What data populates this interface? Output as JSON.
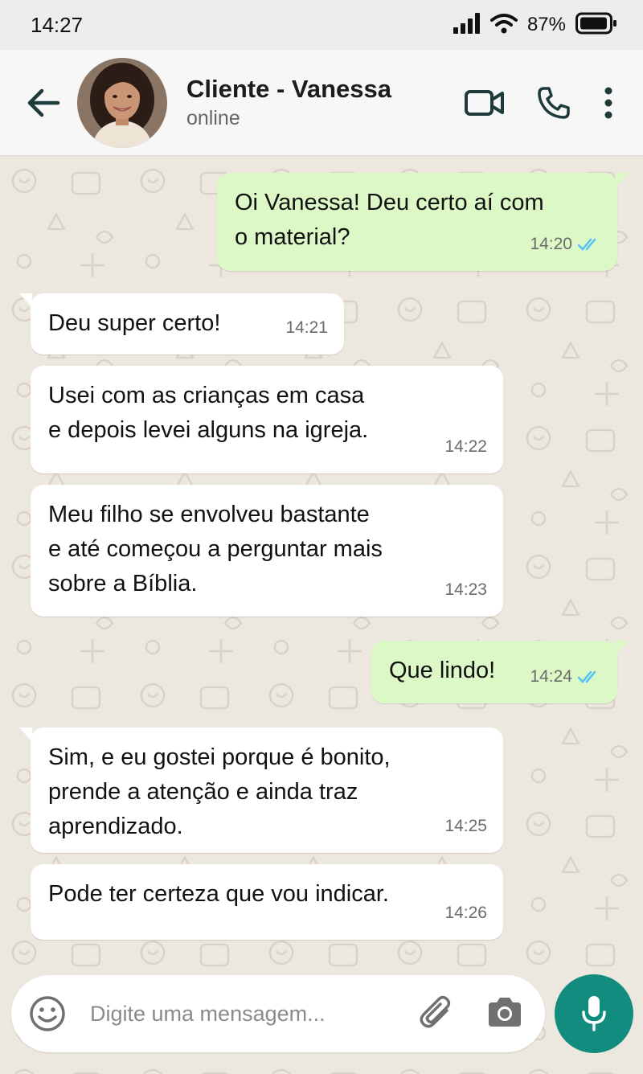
{
  "status_bar": {
    "time": "14:27",
    "battery": "87%"
  },
  "header": {
    "contact_name": "Cliente - Vanessa",
    "contact_status": "online"
  },
  "messages": [
    {
      "dir": "out",
      "text": "Oi Vanessa! Deu certo aí com\no material?",
      "time": "14:20",
      "read": true
    },
    {
      "dir": "in",
      "text": "Deu super certo!",
      "time": "14:21"
    },
    {
      "dir": "in",
      "text": "Usei com as crianças em casa\ne depois levei alguns na igreja.",
      "time": "14:22"
    },
    {
      "dir": "in",
      "text": "Meu filho se envolveu bastante\ne até começou a perguntar mais\nsobre a Bíblia.",
      "time": "14:23"
    },
    {
      "dir": "out",
      "text": "Que lindo!",
      "time": "14:24",
      "read": true
    },
    {
      "dir": "in",
      "text": "Sim, e eu gostei porque é bonito,\nprende a atenção e ainda traz\naprendizado.",
      "time": "14:25"
    },
    {
      "dir": "in",
      "text": "Pode ter certeza que vou indicar.",
      "time": "14:26"
    }
  ],
  "input": {
    "placeholder": "Digite uma mensagem..."
  },
  "colors": {
    "accent": "#128c7e",
    "outgoing_bubble": "#dcf8c6",
    "incoming_bubble": "#ffffff",
    "read_ticks": "#4fc3f7",
    "header_icons": "#1e3a3a"
  },
  "icons": [
    "back-arrow-icon",
    "video-call-icon",
    "phone-icon",
    "more-options-icon",
    "emoji-icon",
    "attach-icon",
    "camera-icon",
    "mic-icon",
    "read-receipt-icon",
    "signal-icon",
    "wifi-icon",
    "battery-icon"
  ]
}
